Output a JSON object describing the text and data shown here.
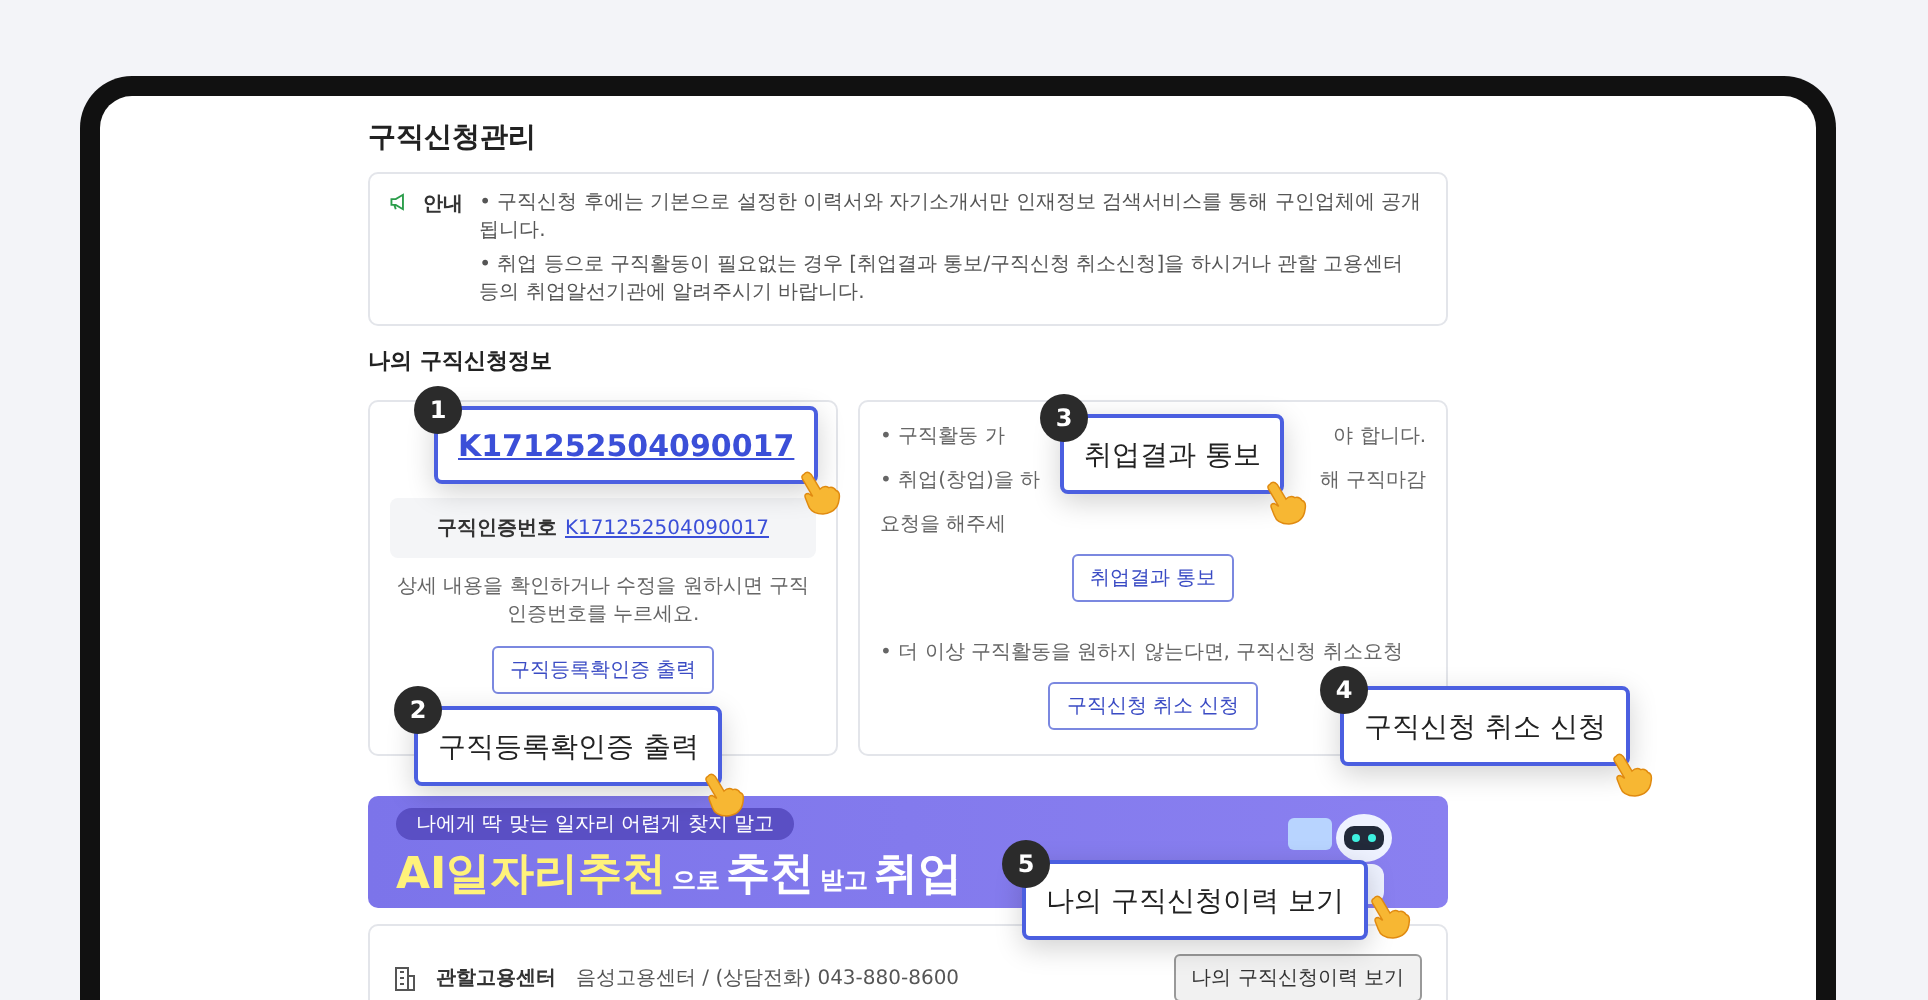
{
  "page_title": "구직신청관리",
  "notice": {
    "label": "안내",
    "items": [
      "• 구직신청 후에는 기본으로 설정한 이력서와 자기소개서만 인재정보 검색서비스를 통해 구인업체에 공개됩니다.",
      "• 취업 등으로 구직활동이 필요없는 경우 [취업결과 통보/구직신청 취소신청]을 하시거나 관할 고용센터 등의 취업알선기관에 알려주시기 바랍니다."
    ]
  },
  "section_title": "나의 구직신청정보",
  "left_card": {
    "id_label": "구직인증번호",
    "id_value": "K171252504090017",
    "hint": "상세 내용을 확인하거나 수정을 원하시면 구직인증번호를 누르세요.",
    "button": "구직등록확인증 출력"
  },
  "right_card": {
    "lines": [
      {
        "parts": [
          "• 구직활동 가",
          "야 합니다."
        ]
      },
      {
        "parts": [
          "• 취업(창업)을 하",
          "해 구직마감"
        ]
      },
      {
        "parts": [
          "요청을 해주세"
        ]
      }
    ],
    "button_1": "취업결과 통보",
    "line_2": "• 더 이상 구직활동을 원하지 않는다면, 구직신청 취소요청",
    "button_2": "구직신청 취소 신청"
  },
  "banner": {
    "pill": "나에게 딱 맞는 일자리 어렵게 찾지 말고",
    "headline": [
      {
        "text": "AI일자리추천",
        "kind": "highlight"
      },
      {
        "text": "으로",
        "kind": "small"
      },
      {
        "text": "추천",
        "kind": "big"
      },
      {
        "text": "받고",
        "kind": "small"
      },
      {
        "text": "취업",
        "kind": "big"
      }
    ]
  },
  "center": {
    "label": "관할고용센터",
    "value": "음성고용센터 / (상담전화) 043-880-8600",
    "button": "나의 구직신청이력 보기"
  },
  "callouts": [
    {
      "number": "1",
      "text": "K171252504090017",
      "kind": "link"
    },
    {
      "number": "2",
      "text": "구직등록확인증 출력",
      "kind": "plain"
    },
    {
      "number": "3",
      "text": "취업결과 통보",
      "kind": "plain"
    },
    {
      "number": "4",
      "text": "구직신청 취소 신청",
      "kind": "plain"
    },
    {
      "number": "5",
      "text": "나의 구직신청이력 보기",
      "kind": "plain"
    }
  ]
}
